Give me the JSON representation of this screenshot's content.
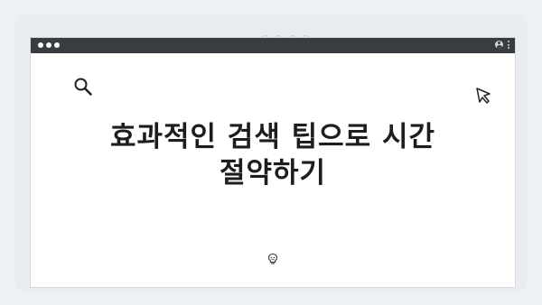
{
  "page": {
    "title_line1": "효과적인 검색 팁으로 시간",
    "title_line2": "절약하기"
  },
  "icons": {
    "search": "search-icon",
    "cursor": "cursor-arrow-icon",
    "lightbulb": "lightbulb-icon",
    "profile": "profile-icon",
    "menu": "kebab-menu-icon"
  },
  "colors": {
    "titlebar": "#393d42",
    "background": "#eef1f4",
    "window": "#ffffff",
    "text": "#1d1d1f"
  }
}
